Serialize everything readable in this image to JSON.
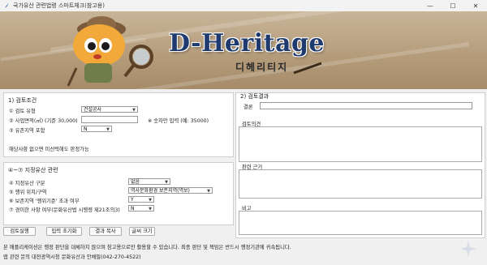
{
  "window": {
    "title": "국가유산 관련법령 스마트체크(참고용)",
    "btn_min": "—",
    "btn_max": "☐",
    "btn_close": "✕"
  },
  "banner": {
    "logo": "D-Heritage",
    "subtitle": "디헤리티지"
  },
  "left": {
    "section1_title": "1) 검토조건",
    "type_label": "① 검토 유형",
    "type_value": "건설공사",
    "area_label": "② 사업면적(㎡) (기준 30,000)",
    "area_value": "",
    "area_hint": "※ 숫자만 입력 (예: 35000)",
    "protect_label": "③ 유존지역 포함",
    "protect_value": "N",
    "note": "해당사항 없으면 미선택해도 판정가능",
    "section2_title": "④~⑦ 지정유산 관련",
    "q4_label": "④ 지정유산 구분",
    "q4_value": "없음",
    "q5_label": "⑤ 행위 위치/구역",
    "q5_value": "역사문화환경 보존지역(역보)",
    "q6_label": "⑥ 보존지역 '행위기준' 초과 여부",
    "q6_value": "Y",
    "q7_label": "⑦ 경미한 사항 여부(문화유산법 시행령 제21조의3)",
    "q7_value": "N"
  },
  "buttons": {
    "run": "검토실행",
    "reset": "입력 초기화",
    "copy": "결과 복사",
    "font": "글씨 크기"
  },
  "right": {
    "result_title": "2) 검토결과",
    "conclusion_label": "결론",
    "opinion_label": "검토의견",
    "basis_label": "판련 근거",
    "remark_label": "비고"
  },
  "footer": {
    "line1": "본 애플리케이션은 행정 판단을 대체하지 않으며 참고용으로만 활용할 수 있습니다. 최종 판단 및 책임은 반드시 행정기관에 귀속됩니다.",
    "line2": "앱 관련 문의 대전광역시청 문화유산과 안채필(042-270-4522)"
  }
}
